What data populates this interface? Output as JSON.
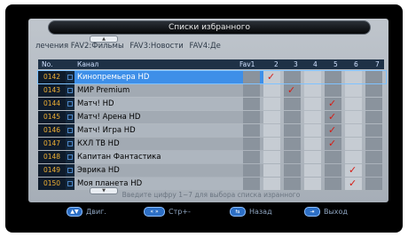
{
  "title": "Списки избранного",
  "fav_tabs": [
    "лечения FAV2:Фильмы",
    "FAV3:Новости",
    "FAV4:Де"
  ],
  "header": {
    "no": "No.",
    "channel": "Канал",
    "cols": [
      "Fav1",
      "2",
      "3",
      "4",
      "5",
      "6",
      "7"
    ]
  },
  "rows": [
    {
      "num": "0142",
      "name": "Кинопремьера HD",
      "favs": [
        1
      ]
    },
    {
      "num": "0143",
      "name": "МИР Premium",
      "favs": [
        2
      ]
    },
    {
      "num": "0144",
      "name": "Матч! HD",
      "favs": [
        4
      ]
    },
    {
      "num": "0145",
      "name": "Матч! Арена HD",
      "favs": [
        4
      ]
    },
    {
      "num": "0146",
      "name": "Матч! Игра HD",
      "favs": [
        4
      ]
    },
    {
      "num": "0147",
      "name": "КХЛ ТВ HD",
      "favs": [
        4
      ]
    },
    {
      "num": "0148",
      "name": "Капитан Фантастика",
      "favs": []
    },
    {
      "num": "0149",
      "name": "Эврика HD",
      "favs": [
        5
      ]
    },
    {
      "num": "0150",
      "name": "Моя планета HD",
      "favs": [
        5
      ]
    }
  ],
  "hint": "Введите цифру 1~7 для выбора списка изранного",
  "footer": {
    "move": "Двиг.",
    "page": "Стр+-",
    "back": "Назад",
    "exit": "Выход",
    "move_key": "▲▼",
    "page_key": "« »",
    "back_key": "⇆",
    "exit_key": "⇥"
  },
  "selected_index": 0,
  "colors": {
    "selected_row": "#3e8fe8",
    "check": "#d61b14",
    "number": "#f0b033"
  }
}
